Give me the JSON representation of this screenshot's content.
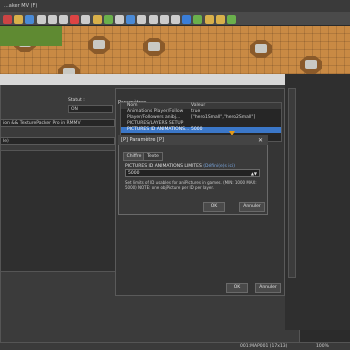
{
  "app": {
    "title": "...aker MV (F)"
  },
  "toolbar": {
    "icons": [
      "new-icon",
      "open-icon",
      "save-icon",
      "cut-icon",
      "copy-icon",
      "paste-icon",
      "delete-icon",
      "undo-icon",
      "pencil-icon",
      "rectangle-icon",
      "ellipse-icon",
      "fill-icon",
      "shadow-pen-icon",
      "zoom-in-icon",
      "zoom-out-icon",
      "actual-size-icon",
      "database-icon",
      "plugin-icon",
      "sound-icon",
      "character-icon",
      "playtest-icon"
    ],
    "colors": [
      "#c44",
      "#d8b04a",
      "#4a8ad6",
      "#ccc",
      "#ccc",
      "#ccc",
      "#d44",
      "#ccc",
      "#d8b04a",
      "#6ab04c",
      "#ccc",
      "#4a8ad6",
      "#ccc",
      "#ccc",
      "#ccc",
      "#ccc",
      "#3a7ed8",
      "#6ab04c",
      "#d8b04a",
      "#d8b04a",
      "#6ab04c"
    ]
  },
  "database": {
    "status_label": "Statut :",
    "status_value": "ON",
    "desc_line": "ion && TexturePacker Pro in RMMV",
    "author": "le)"
  },
  "plugin": {
    "params_header": "Paramètres",
    "col_name": "Nom",
    "col_value": "Valeur",
    "rows": [
      {
        "name": "Animations Player/Follow",
        "value": "true"
      },
      {
        "name": "Player/Followers anibj...",
        "value": "[\"hero1Small\",\"hero2Small\"]"
      },
      {
        "name": "PICTURES/LAYERS SETUP",
        "value": ""
      },
      {
        "name": "PICTURES ID ANIMATIONS...",
        "value": "5000"
      }
    ],
    "ok": "OK",
    "cancel": "Annuler"
  },
  "param_dialog": {
    "title": "[P] Paramètre [P]",
    "tab_number": "Chiffre",
    "tab_text": "Texte",
    "label": "PICTURES ID ANIMATIONS LIMITES",
    "label_hint": "(Défini(e)s ici)",
    "value": "5000",
    "description": "Set limits of ID usables for aniPictures in games. (MIN: 1000 MAX: 5000) NOTE: one objPicture per ID  per layer.",
    "ok": "OK",
    "cancel": "Annuler"
  },
  "statusbar": {
    "map": "001:MAP001 (17x13)",
    "zoom": "100%"
  }
}
